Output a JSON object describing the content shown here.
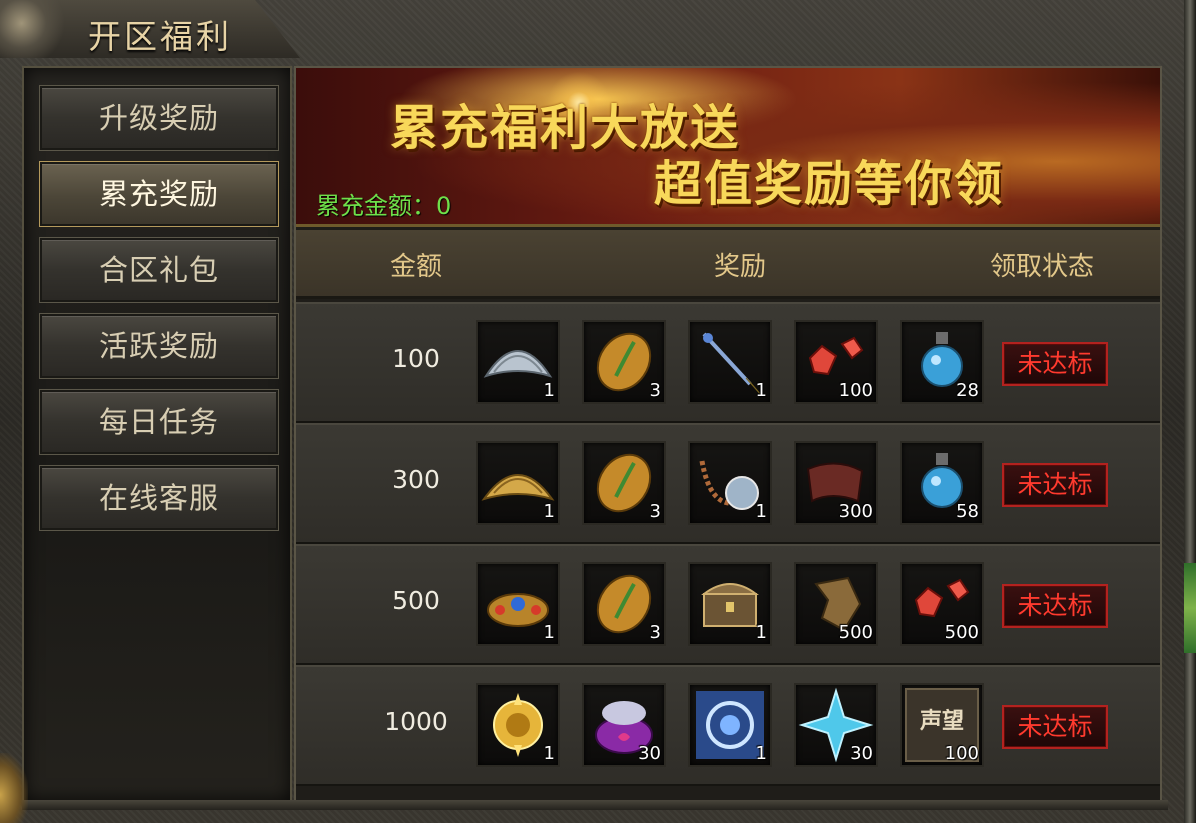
{
  "window": {
    "title": "开区福利"
  },
  "sidebar": {
    "items": [
      {
        "label": "升级奖励",
        "active": false
      },
      {
        "label": "累充奖励",
        "active": true
      },
      {
        "label": "合区礼包",
        "active": false
      },
      {
        "label": "活跃奖励",
        "active": false
      },
      {
        "label": "每日任务",
        "active": false
      },
      {
        "label": "在线客服",
        "active": false
      }
    ]
  },
  "banner": {
    "line1": "累充福利大放送",
    "line2": "超值奖励等你领",
    "amount_label": "累充金额：0"
  },
  "table": {
    "headers": {
      "amount": "金额",
      "reward": "奖励",
      "status": "领取状态"
    },
    "rows": [
      {
        "amount": "100",
        "status": "未达标",
        "items": [
          {
            "icon": "silver-bamboo-hat-icon",
            "qty": "1"
          },
          {
            "icon": "golden-seed-icon",
            "qty": "3"
          },
          {
            "icon": "blue-spear-icon",
            "qty": "1"
          },
          {
            "icon": "red-gem-icon",
            "qty": "100"
          },
          {
            "icon": "blue-potion-icon",
            "qty": "28"
          }
        ]
      },
      {
        "amount": "300",
        "status": "未达标",
        "items": [
          {
            "icon": "gold-bamboo-hat-icon",
            "qty": "1"
          },
          {
            "icon": "golden-seed-icon",
            "qty": "3"
          },
          {
            "icon": "amulet-necklace-icon",
            "qty": "1"
          },
          {
            "icon": "scroll-cloth-icon",
            "qty": "300"
          },
          {
            "icon": "blue-potion-icon",
            "qty": "58"
          }
        ]
      },
      {
        "amount": "500",
        "status": "未达标",
        "items": [
          {
            "icon": "jeweled-crown-icon",
            "qty": "1"
          },
          {
            "icon": "golden-seed-icon",
            "qty": "3"
          },
          {
            "icon": "treasure-chest-icon",
            "qty": "1"
          },
          {
            "icon": "leather-scrap-icon",
            "qty": "500"
          },
          {
            "icon": "red-gem-icon",
            "qty": "500"
          }
        ]
      },
      {
        "amount": "1000",
        "status": "未达标",
        "items": [
          {
            "icon": "golden-emblem-icon",
            "qty": "1"
          },
          {
            "icon": "purple-gift-bag-icon",
            "qty": "30"
          },
          {
            "icon": "blue-rune-icon",
            "qty": "1"
          },
          {
            "icon": "blue-crystal-star-icon",
            "qty": "30"
          },
          {
            "icon": "reputation-token-icon",
            "qty": "100",
            "text": "声望"
          }
        ]
      }
    ]
  },
  "colors": {
    "accent_gold": "#e3c88a",
    "banner_text": "#f8d85a",
    "amount_green": "#6fe04a",
    "status_red": "#ff3a2e"
  }
}
